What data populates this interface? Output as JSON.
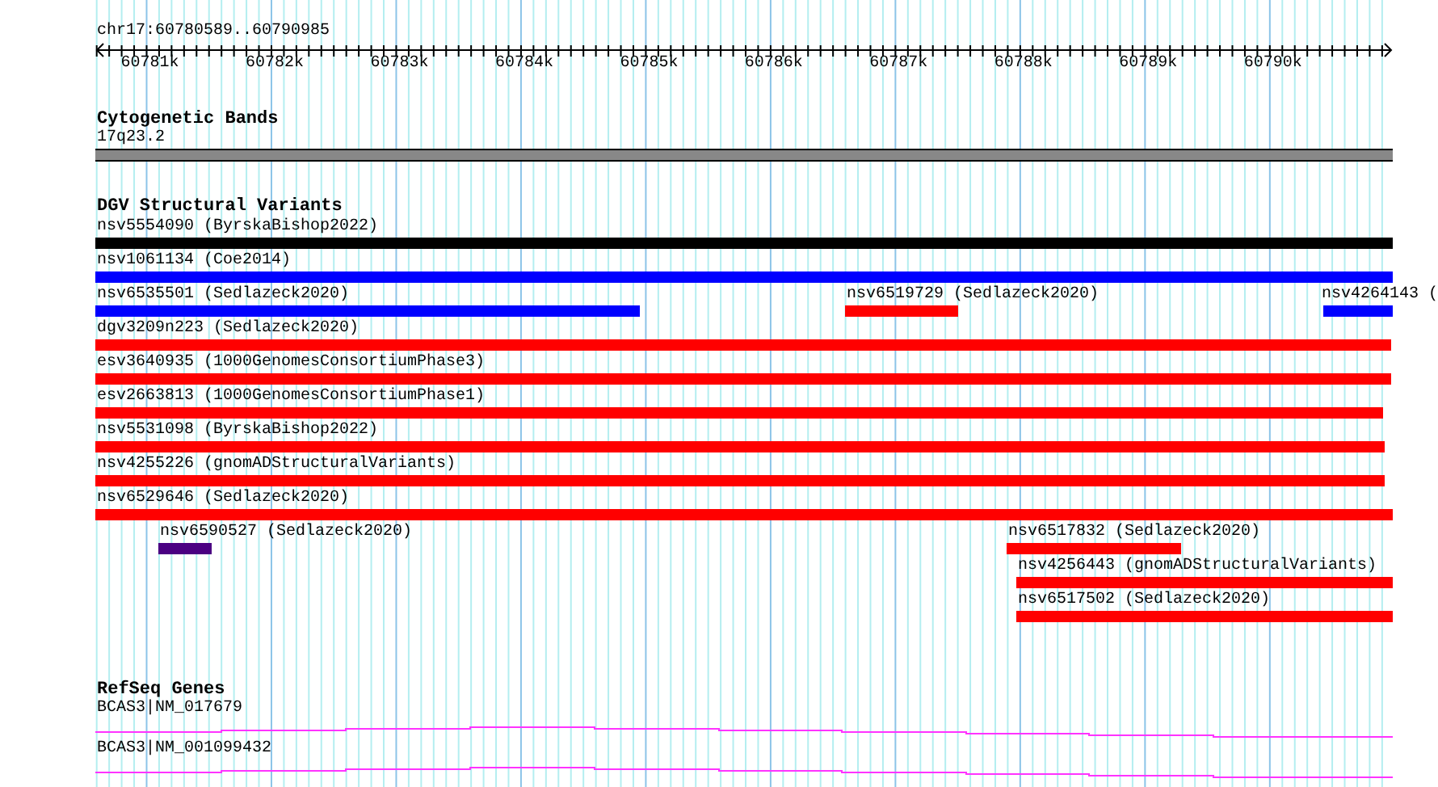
{
  "ruler": {
    "location": "chr17:60780589..60790985",
    "ticks": [
      "60781k",
      "60782k",
      "60783k",
      "60784k",
      "60785k",
      "60786k",
      "60787k",
      "60788k",
      "60789k",
      "60790k"
    ]
  },
  "cytobands": {
    "title": "Cytogenetic Bands",
    "band": "17q23.2"
  },
  "dgv": {
    "title": "DGV Structural Variants",
    "rows": [
      {
        "features": [
          {
            "label": "nsv5554090 (ByrskaBishop2022)",
            "color": "#000000"
          }
        ]
      },
      {
        "features": [
          {
            "label": "nsv1061134 (Coe2014)",
            "color": "#0000ff"
          }
        ]
      },
      {
        "features": [
          {
            "label": "nsv6535501 (Sedlazeck2020)",
            "color": "#0000ff"
          },
          {
            "label": "nsv6519729 (Sedlazeck2020)",
            "color": "#ff0000"
          },
          {
            "label": "nsv4264143 (",
            "color": "#0000ff"
          }
        ]
      },
      {
        "features": [
          {
            "label": "dgv3209n223 (Sedlazeck2020)",
            "color": "#ff0000"
          }
        ]
      },
      {
        "features": [
          {
            "label": "esv3640935 (1000GenomesConsortiumPhase3)",
            "color": "#ff0000"
          }
        ]
      },
      {
        "features": [
          {
            "label": "esv2663813 (1000GenomesConsortiumPhase1)",
            "color": "#ff0000"
          }
        ]
      },
      {
        "features": [
          {
            "label": "nsv5531098 (ByrskaBishop2022)",
            "color": "#ff0000"
          }
        ]
      },
      {
        "features": [
          {
            "label": "nsv4255226 (gnomADStructuralVariants)",
            "color": "#ff0000"
          }
        ]
      },
      {
        "features": [
          {
            "label": "nsv6529646 (Sedlazeck2020)",
            "color": "#ff0000"
          }
        ]
      },
      {
        "features": [
          {
            "label": "nsv6590527 (Sedlazeck2020)",
            "color": "#4b0082"
          },
          {
            "label": "nsv6517832 (Sedlazeck2020)",
            "color": "#ff0000"
          }
        ]
      },
      {
        "features": [
          {
            "label": "nsv4256443 (gnomADStructuralVariants)",
            "color": "#ff0000"
          }
        ]
      },
      {
        "features": [
          {
            "label": "nsv6517502 (Sedlazeck2020)",
            "color": "#ff0000"
          }
        ]
      }
    ]
  },
  "refseq": {
    "title": "RefSeq Genes",
    "transcripts": [
      "BCAS3|NM_017679",
      "BCAS3|NM_001099432"
    ]
  }
}
